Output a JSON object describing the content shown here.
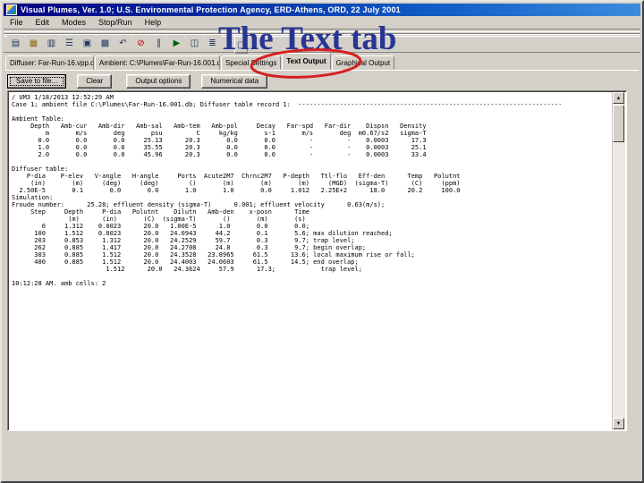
{
  "overlay": {
    "title": "The Text tab",
    "circle_color": "#d42020"
  },
  "window": {
    "title": "Visual Plumes,   Ver. 1.0;   U.S. Environmental Protection Agency,   ERD-Athens,   ORD,   22 July 2001",
    "menu": [
      "File",
      "Edit",
      "Modes",
      "Stop/Run",
      "Help"
    ],
    "toolbar_icons": [
      {
        "name": "new-file-icon",
        "glyph": "▤"
      },
      {
        "name": "open-folder-icon",
        "glyph": "▦"
      },
      {
        "name": "save-icon",
        "glyph": "▥"
      },
      {
        "name": "print-icon",
        "glyph": "☰"
      },
      {
        "name": "copy-icon",
        "glyph": "▣"
      },
      {
        "name": "paste-icon",
        "glyph": "▩"
      },
      {
        "name": "undo-icon",
        "glyph": "↶"
      },
      {
        "name": "stop-icon",
        "glyph": "⊘"
      },
      {
        "name": "pause-icon",
        "glyph": "∥"
      },
      {
        "name": "run-icon",
        "glyph": "▶"
      },
      {
        "name": "chart-icon",
        "glyph": "◫"
      },
      {
        "name": "text-icon",
        "glyph": "≣"
      },
      {
        "name": "window-icon",
        "glyph": "▢"
      }
    ],
    "tabs": [
      {
        "label": "Diffuser: Far-Run-16.vpp.db"
      },
      {
        "label": "Ambient: C:\\Plumes\\Far-Run-16.001.db"
      },
      {
        "label": "Special Settings"
      },
      {
        "label": "Text Output"
      },
      {
        "label": "Graphical Output"
      }
    ],
    "buttons": [
      "Save to file...",
      "Clear",
      "Output options",
      "Numerical data"
    ],
    "scrollbar": {
      "up_glyph": "▲",
      "down_glyph": "▼"
    }
  },
  "console": {
    "lines": [
      "/ UM3 1/18/2013 12:52:29 AM",
      "Case 1; ambient file C:\\Plumes\\Far-Run-16.001.db; Diffuser table record 1:  ----------------------------------------------------------------------",
      "",
      "Ambient Table:",
      "     Depth   Amb-cur   Amb-dir   Amb-sal   Amb-tem   Amb-pol     Decay   Far-spd   Far-dir    Dispsn   Density",
      "         m       m/s       deg       psu         C     kg/kg       s-1       m/s       deg  m0.67/s2   sigma-T",
      "       0.0       0.0       0.0     25.13      20.3       0.0       0.0         -         -    0.0003      17.3",
      "       1.0       0.0       0.0     35.55      20.3       0.0       0.0         -         -    0.0003      25.1",
      "       2.0       0.0       0.0     45.96      20.3       0.0       0.0         -         -    0.0003      33.4",
      "",
      "Diffuser table:",
      "    P-dia    P-elev   V-angle   H-angle     Ports  Acute2M7  Chrnc2M7   P-depth   Ttl-flo   Eff-den      Temp   Polutnt",
      "     (in)       (m)     (deg)     (deg)        ()       (m)       (m)       (m)     (MGD)  (sigma-T)      (C)     (ppm)",
      "  2.50E-5       0.1       0.0       0.0       1.0       1.0       0.0     1.012   2.25E+2      18.0      20.2     100.0",
      "Simulation:",
      "Froude number:      25.28; effluent density (sigma-T)      0.001; effluent velocity      0.63(m/s);",
      "     Step     Depth     P-dia   Polutnt    Dilutn   Amb-den    x-posn      Time",
      "               (m)      (in)       (C)  (sigma-T)       ()       (m)       (s)",
      "        0     1.312    0.0023      20.0   1.00E-5      1.0       0.0       0.0;",
      "      100     1.512    0.0023      20.0   24.0943     44.2       0.1       5.6; max dilution reached;",
      "      203     0.853     1.312      20.0   24.2529     59.7       0.3       9.7; trap level;",
      "      262     0.885     1.417      20.0   24.2708     24.8       0.3       9.7; begin overlap;",
      "      303     0.885     1.512      20.0   24.3528   23.8965     61.5      13.6; local maximum rise or fall;",
      "      400     0.885     1.512      20.0   24.4003   24.0603     61.5      14.5; end overlap;",
      "                         1.512      20.0   24.3624     57.9      17.3;            trap level;",
      "",
      "10:12:28 AM. amb cells: 2"
    ]
  }
}
